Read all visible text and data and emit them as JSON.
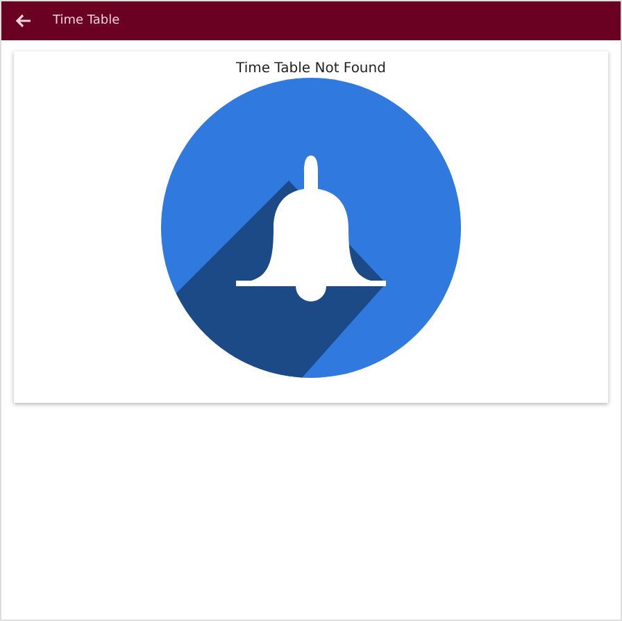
{
  "header": {
    "title": "Time Table"
  },
  "message": "Time Table Not Found"
}
